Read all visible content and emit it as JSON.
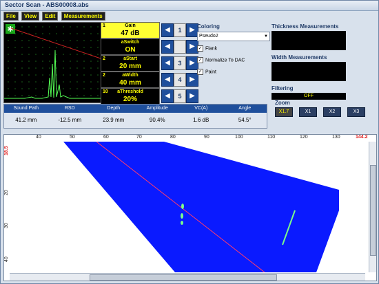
{
  "window": {
    "title": "Sector Scan - ABS00008.abs"
  },
  "menu": {
    "file": "File",
    "view": "View",
    "edit": "Edit",
    "measurements": "Measurements"
  },
  "ascan": {
    "icon": "snowflake-icon"
  },
  "params": [
    {
      "num": "1",
      "label": "Gain",
      "value": "47 dB",
      "mid": "1"
    },
    {
      "num": "",
      "label": "aSwitch",
      "value": "ON",
      "mid": ""
    },
    {
      "num": "2",
      "label": "aStart",
      "value": "20 mm",
      "mid": "3"
    },
    {
      "num": "2",
      "label": "aWidth",
      "value": "40 mm",
      "mid": "4"
    },
    {
      "num": "10",
      "label": "aThreshold",
      "value": "20%",
      "mid": "5"
    }
  ],
  "coloring": {
    "title": "Coloring",
    "palette": "Pseudo2",
    "flank": "Flank",
    "normalize": "Normalize To DAC",
    "paint": "Paint"
  },
  "right": {
    "thickness": "Thickness Measurements",
    "width": "Width Measurements",
    "filtering": "Filtering",
    "filtering_value": "OFF",
    "zoom": "Zoom",
    "zoom_x17": "X1.7",
    "zoom_x1": "X1",
    "zoom_x2": "X2",
    "zoom_x3": "X3"
  },
  "measurements": {
    "headers": [
      "Sound Path",
      "RSD",
      "Depth",
      "Amplitude",
      "VC(A)",
      "Angle"
    ],
    "values": [
      "41.2 mm",
      "-12.5 mm",
      "23.9 mm",
      "90.4%",
      "1.6 dB",
      "54.5°"
    ]
  },
  "scan": {
    "top_ticks": [
      "40",
      "50",
      "60",
      "70",
      "80",
      "90",
      "100",
      "110",
      "120",
      "130",
      "144.2"
    ],
    "left_ticks": [
      "18.5",
      "20",
      "30",
      "40"
    ],
    "colors": {
      "fan": "#0a1aff",
      "cursor": "#ff3b6b",
      "mark": "#7cfb8a",
      "limit": "#ff3030"
    }
  }
}
